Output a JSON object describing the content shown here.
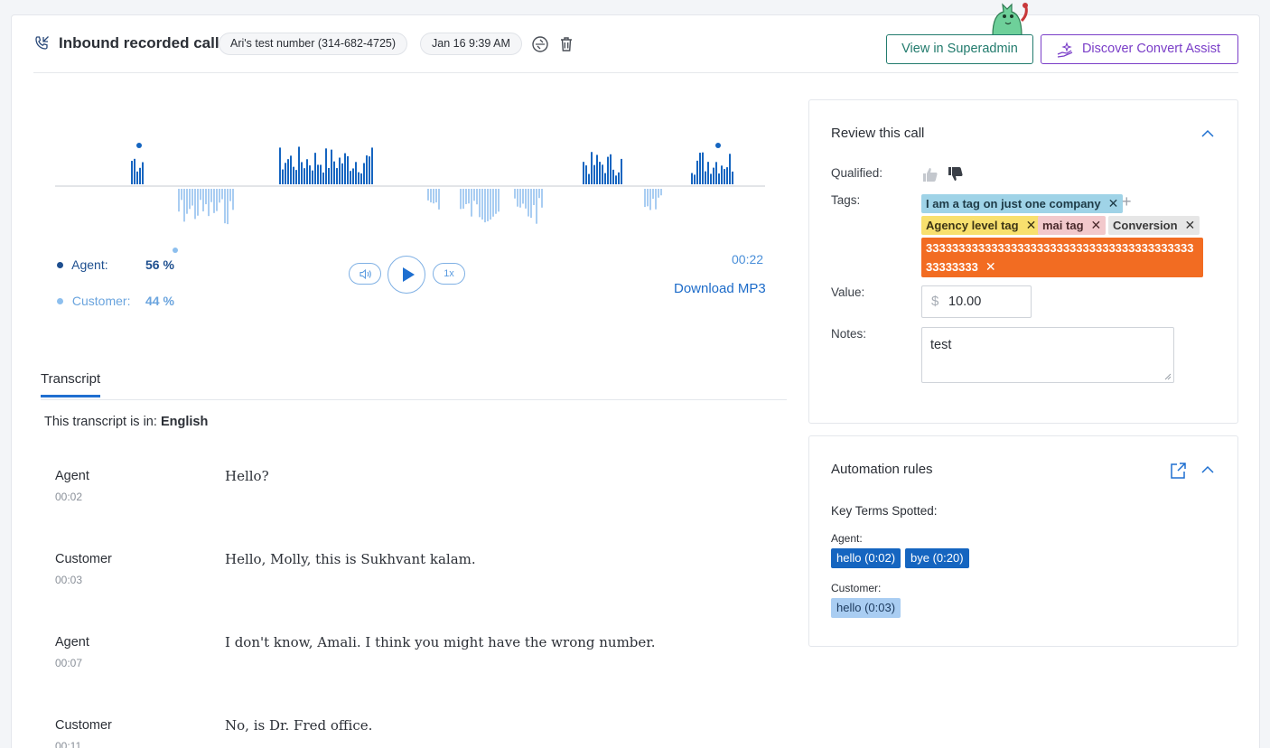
{
  "header": {
    "title": "Inbound recorded call",
    "number_pill": "Ari's test number (314-682-4725)",
    "date_pill": "Jan 16  9:39 AM",
    "superadmin_button": "View in Superadmin",
    "convert_assist_button": "Discover Convert Assist"
  },
  "player": {
    "agent_label": "Agent:",
    "agent_pct": "56 %",
    "customer_label": "Customer:",
    "customer_pct": "44 %",
    "speed": "1x",
    "time": "00:22",
    "download": "Download MP3",
    "colors": {
      "agent": "#1565c0",
      "customer": "#a9cdf2"
    }
  },
  "transcript": {
    "tab": "Transcript",
    "lang_prefix": "This transcript is in:",
    "lang": "English",
    "utterances": [
      {
        "speaker": "Agent",
        "time": "00:02",
        "text": "Hello?"
      },
      {
        "speaker": "Customer",
        "time": "00:03",
        "text": "Hello, Molly, this is Sukhvant kalam."
      },
      {
        "speaker": "Agent",
        "time": "00:07",
        "text": "I don't know, Amali. I think you might have the wrong number."
      },
      {
        "speaker": "Customer",
        "time": "00:11",
        "text": "No, is Dr. Fred office."
      }
    ]
  },
  "review": {
    "title": "Review this call",
    "qualified_label": "Qualified:",
    "tags_label": "Tags:",
    "tags": [
      "I am a tag on just one company",
      "Agency level tag",
      "mai tag",
      "Conversion",
      "3333333333333333333333333333333333333333333333333"
    ],
    "value_label": "Value:",
    "value_currency": "$",
    "value": "10.00",
    "notes_label": "Notes:",
    "notes": "test"
  },
  "automation": {
    "title": "Automation rules",
    "key_terms_label": "Key Terms Spotted:",
    "agent_label": "Agent:",
    "agent_terms": [
      "hello (0:02)",
      "bye (0:20)"
    ],
    "customer_label": "Customer:",
    "customer_terms": [
      "hello (0:03)"
    ]
  }
}
